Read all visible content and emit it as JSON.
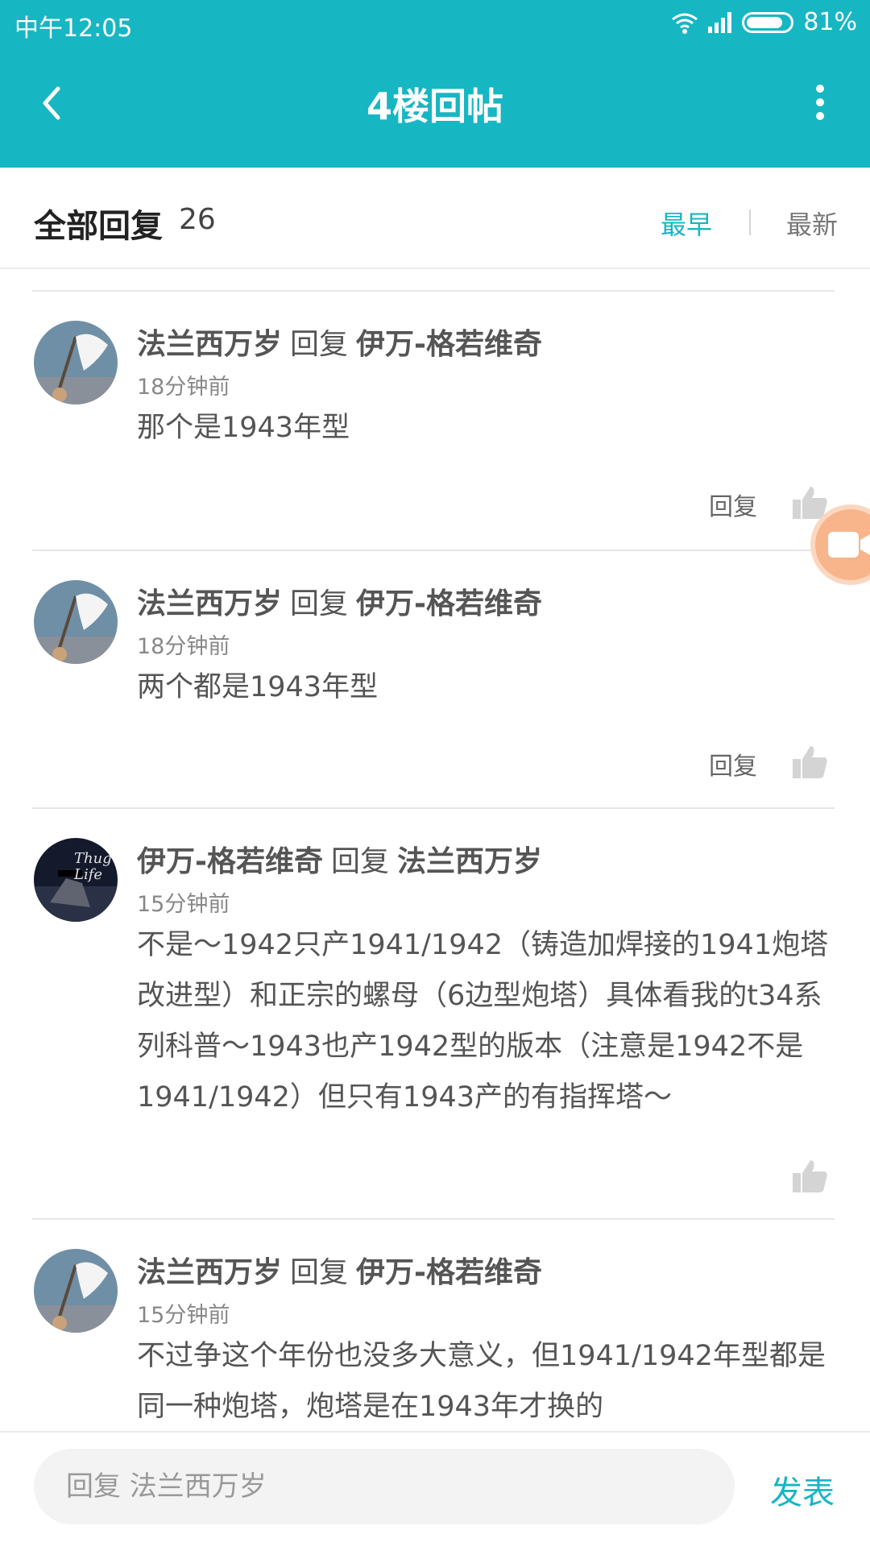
{
  "status_bar": {
    "time": "中午12:05",
    "battery": "81%"
  },
  "header": {
    "title": "4楼回帖"
  },
  "filter": {
    "title": "全部回复",
    "count": "26",
    "sort_earliest": "最早",
    "sort_latest": "最新"
  },
  "replies": [
    {
      "author": "法兰西万岁",
      "reply_word": "回复",
      "target": "伊万-格若维奇",
      "time": "18分钟前",
      "content": "那个是1943年型",
      "reply_label": "回复"
    },
    {
      "author": "法兰西万岁",
      "reply_word": "回复",
      "target": "伊万-格若维奇",
      "time": "18分钟前",
      "content": "两个都是1943年型",
      "reply_label": "回复"
    },
    {
      "author": "伊万-格若维奇",
      "reply_word": "回复",
      "target": "法兰西万岁",
      "time": "15分钟前",
      "content": "不是～1942只产1941/1942（铸造加焊接的1941炮塔改进型）和正宗的螺母（6边型炮塔）具体看我的t34系列科普～1943也产1942型的版本（注意是1942不是1941/1942）但只有1943产的有指挥塔～",
      "avatar_text": "Thug Life"
    },
    {
      "author": "法兰西万岁",
      "reply_word": "回复",
      "target": "伊万-格若维奇",
      "time": "15分钟前",
      "content": "不过争这个年份也没多大意义，但1941/1942年型都是同一种炮塔，炮塔是在1943年才换的"
    }
  ],
  "bottom_bar": {
    "input_placeholder": "回复 法兰西万岁",
    "publish_label": "发表"
  },
  "colors": {
    "accent": "#17b6c3",
    "float_button": "#f8b48a"
  }
}
